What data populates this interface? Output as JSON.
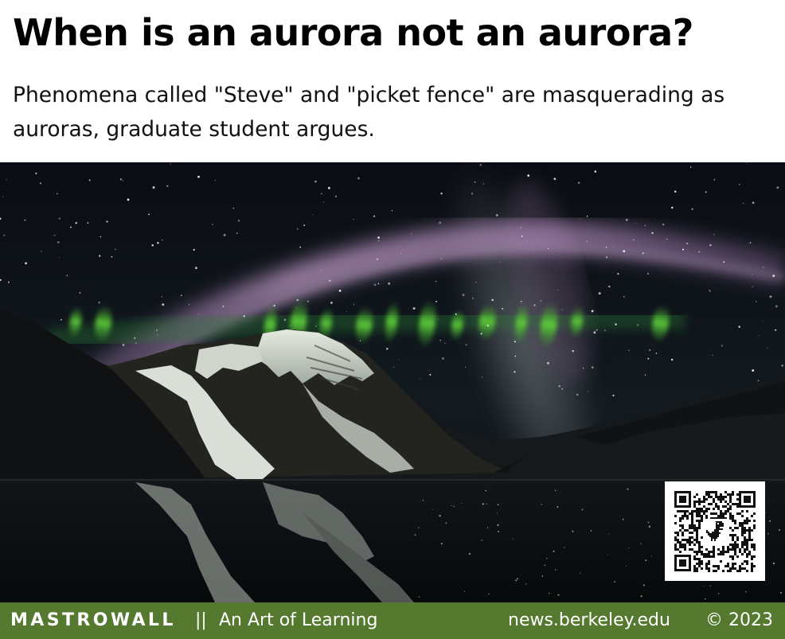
{
  "header": {
    "title": "When is an aurora not an aurora?",
    "subtitle": "Phenomena called \"Steve\" and \"picket fence\" are masquerading as auroras, graduate student argues."
  },
  "photo": {
    "subject": "night-sky-aurora-over-mountain-lake",
    "colors": {
      "sky": "#0b1016",
      "steve_arc": "#b58bc0",
      "picket_fence": "#5fd13a",
      "snow": "#d9ded6",
      "mountain": "#1c1c1a"
    }
  },
  "qr_code": {
    "icon": "dinosaur-icon"
  },
  "footer": {
    "brand": "MASTROWALL",
    "separator": "||",
    "tagline": "An Art of Learning",
    "source": "news.berkeley.edu",
    "copyright": "© 2023",
    "background": "#55792f"
  }
}
